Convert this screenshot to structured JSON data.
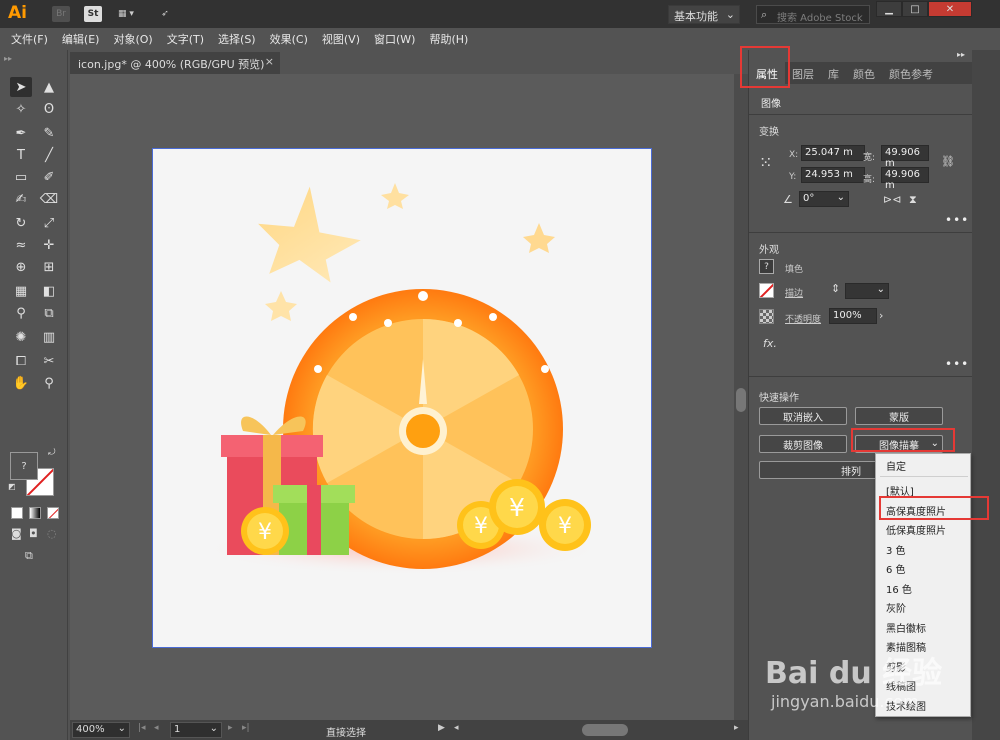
{
  "titlebar": {
    "logo": "Ai",
    "br_icon": "Br",
    "st_icon": "St",
    "layout_icon": "layout-grid-icon",
    "rocket_icon": "rocket-icon",
    "workspace": "基本功能",
    "search_placeholder": "搜索 Adobe Stock",
    "minimize": "▁",
    "maximize": "□",
    "close": "✕"
  },
  "menu": [
    "文件(F)",
    "编辑(E)",
    "对象(O)",
    "文字(T)",
    "选择(S)",
    "效果(C)",
    "视图(V)",
    "窗口(W)",
    "帮助(H)"
  ],
  "document": {
    "tab_title": "icon.jpg* @ 400% (RGB/GPU 预览)",
    "close": "×"
  },
  "status": {
    "zoom": "400%",
    "page": "1",
    "tool_name": "直接选择"
  },
  "toolbar": {
    "fill_unknown": "?"
  },
  "panel": {
    "tabs": [
      "属性",
      "图层",
      "库",
      "颜色",
      "颜色参考"
    ],
    "active_tab": "属性",
    "object_type": "图像",
    "transform": {
      "title": "变换",
      "x_label": "X:",
      "x_value": "25.047 m",
      "y_label": "Y:",
      "y_value": "24.953 m",
      "w_label": "宽:",
      "w_value": "49.906 m",
      "h_label": "高:",
      "h_value": "49.906 m",
      "angle_value": "0°"
    },
    "appearance": {
      "title": "外观",
      "fill_label": "填色",
      "stroke_label": "描边",
      "opacity_label": "不透明度",
      "opacity_value": "100%",
      "fx_label": "fx."
    },
    "quick_actions": {
      "title": "快速操作",
      "embed_cancel": "取消嵌入",
      "mask": "蒙版",
      "crop_image": "裁剪图像",
      "image_trace": "图像描摹",
      "arrange": "排列"
    }
  },
  "trace_menu": {
    "items": [
      "自定",
      "[默认]",
      "高保真度照片",
      "低保真度照片",
      "3 色",
      "6 色",
      "16 色",
      "灰阶",
      "黑白徽标",
      "素描图稿",
      "剪影",
      "线稿图",
      "技术绘图"
    ],
    "highlighted": "高保真度照片"
  },
  "watermark": {
    "brand": "Bai du 经验",
    "url": "jingyan.baidu.com"
  },
  "colors": {
    "accent_red": "#e53935",
    "artboard_border": "#4a6bd6",
    "ai_orange": "#ff9a00"
  }
}
